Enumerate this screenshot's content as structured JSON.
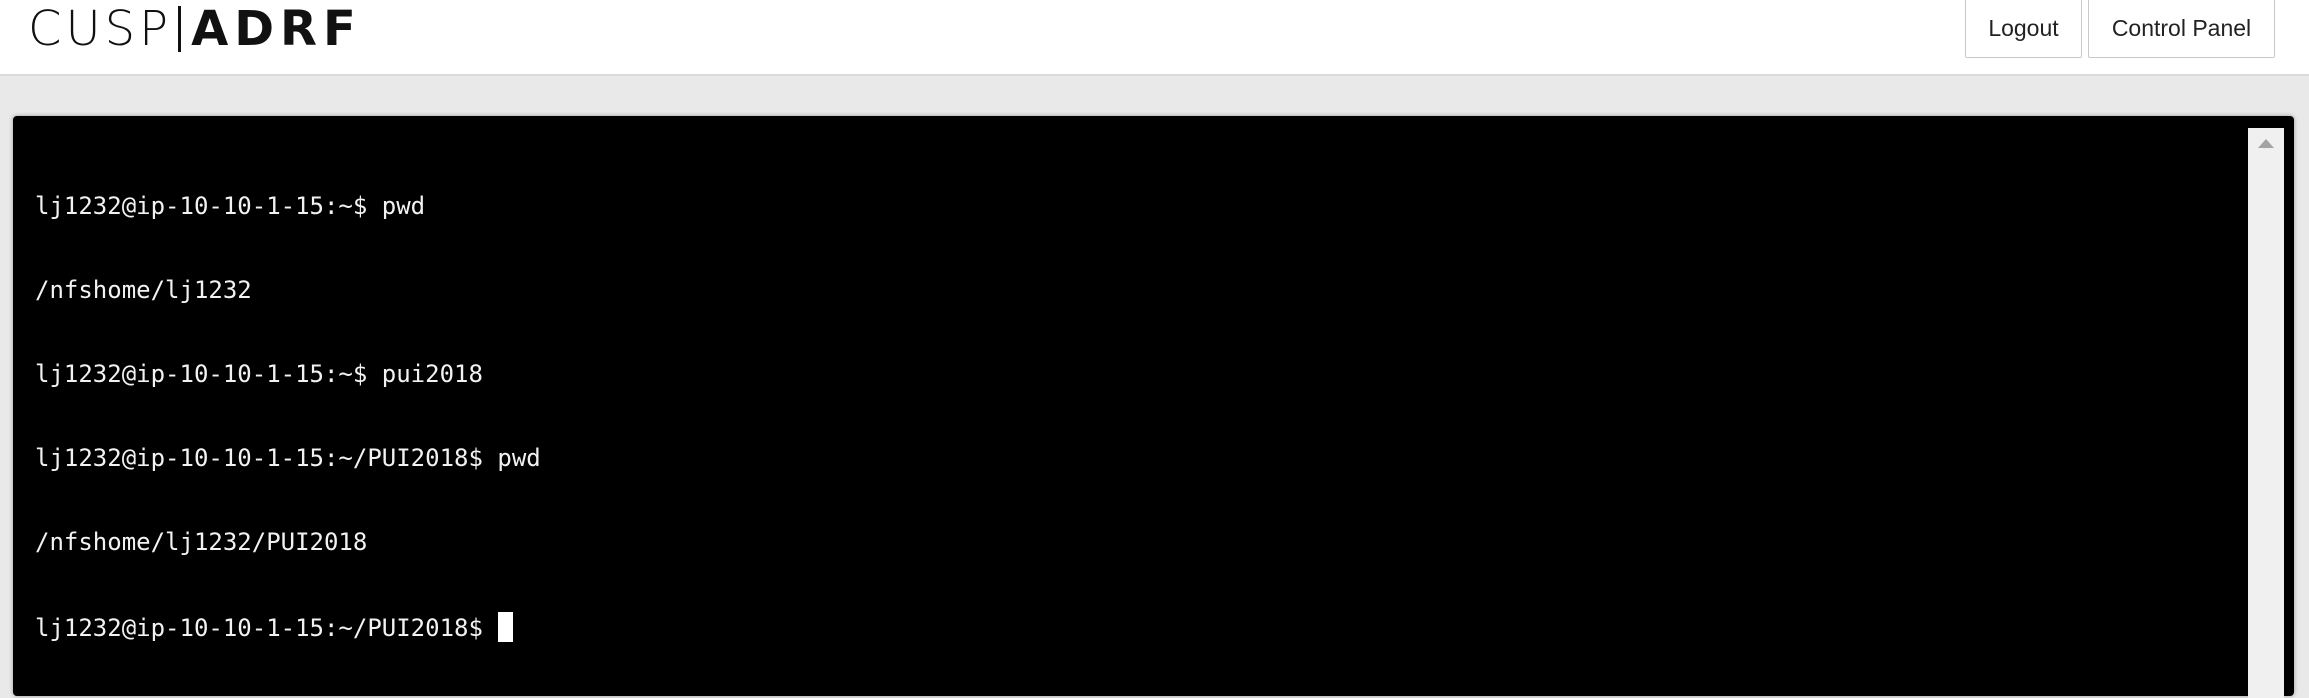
{
  "header": {
    "logo": {
      "part1": "CUSP",
      "part2": "ADRF"
    },
    "logout_label": "Logout",
    "control_panel_label": "Control Panel"
  },
  "terminal": {
    "lines": [
      "lj1232@ip-10-10-1-15:~$ pwd",
      "/nfshome/lj1232",
      "lj1232@ip-10-10-1-15:~$ pui2018",
      "lj1232@ip-10-10-1-15:~/PUI2018$ pwd",
      "/nfshome/lj1232/PUI2018"
    ],
    "current_prompt": "lj1232@ip-10-10-1-15:~/PUI2018$ "
  },
  "icons": {
    "scroll_up": "scroll-up-arrow-icon"
  }
}
